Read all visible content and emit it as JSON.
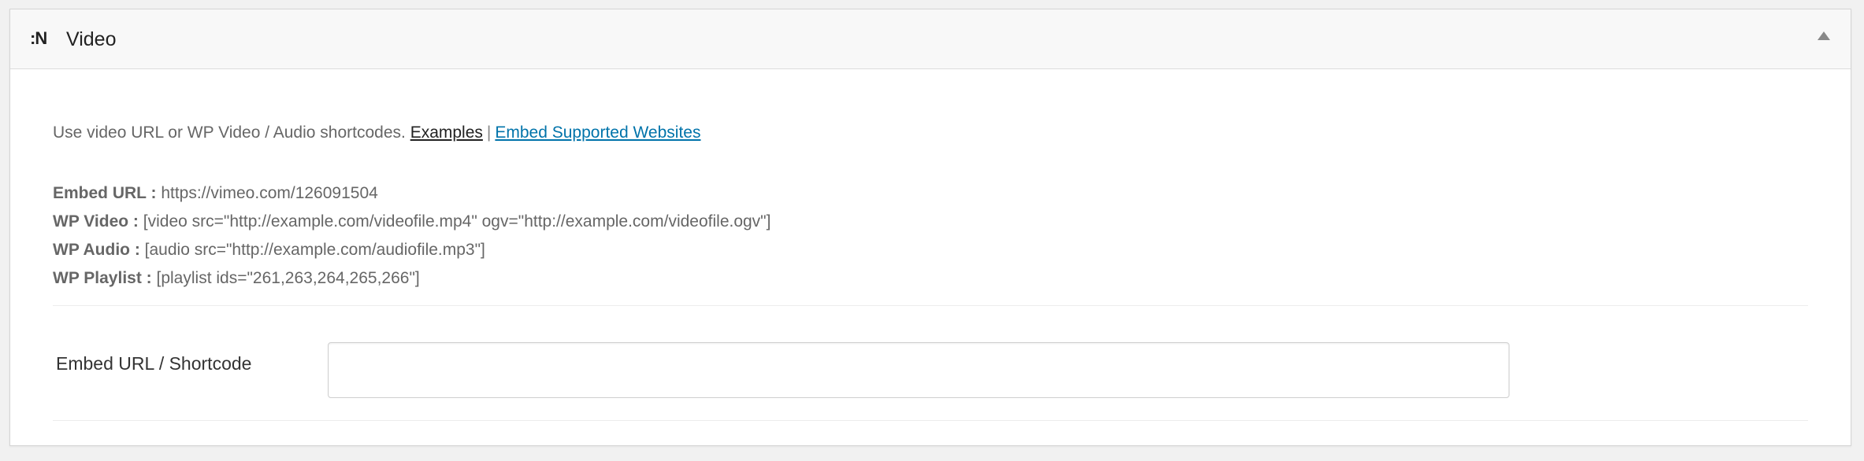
{
  "metabox": {
    "logo_text": ":N",
    "logo_icon": "plugin-logo-icon",
    "title": "Video",
    "toggle_icon": "collapse-arrow-up-icon"
  },
  "description": {
    "text": "Use video URL or WP Video / Audio shortcodes.",
    "examples_link": "Examples",
    "separator": "|",
    "websites_link": "Embed Supported Websites"
  },
  "help": [
    {
      "label": "Embed URL :",
      "value": "https://vimeo.com/126091504"
    },
    {
      "label": "WP Video :",
      "value": "[video src=\"http://example.com/videofile.mp4\" ogv=\"http://example.com/videofile.ogv\"]"
    },
    {
      "label": "WP Audio :",
      "value": "[audio src=\"http://example.com/audiofile.mp3\"]"
    },
    {
      "label": "WP Playlist :",
      "value": "[playlist ids=\"261,263,264,265,266\"]"
    }
  ],
  "field": {
    "label": "Embed URL / Shortcode",
    "value": "",
    "placeholder": ""
  },
  "colors": {
    "link": "#0073aa",
    "header_bg": "#f8f8f8",
    "text": "#666666"
  }
}
